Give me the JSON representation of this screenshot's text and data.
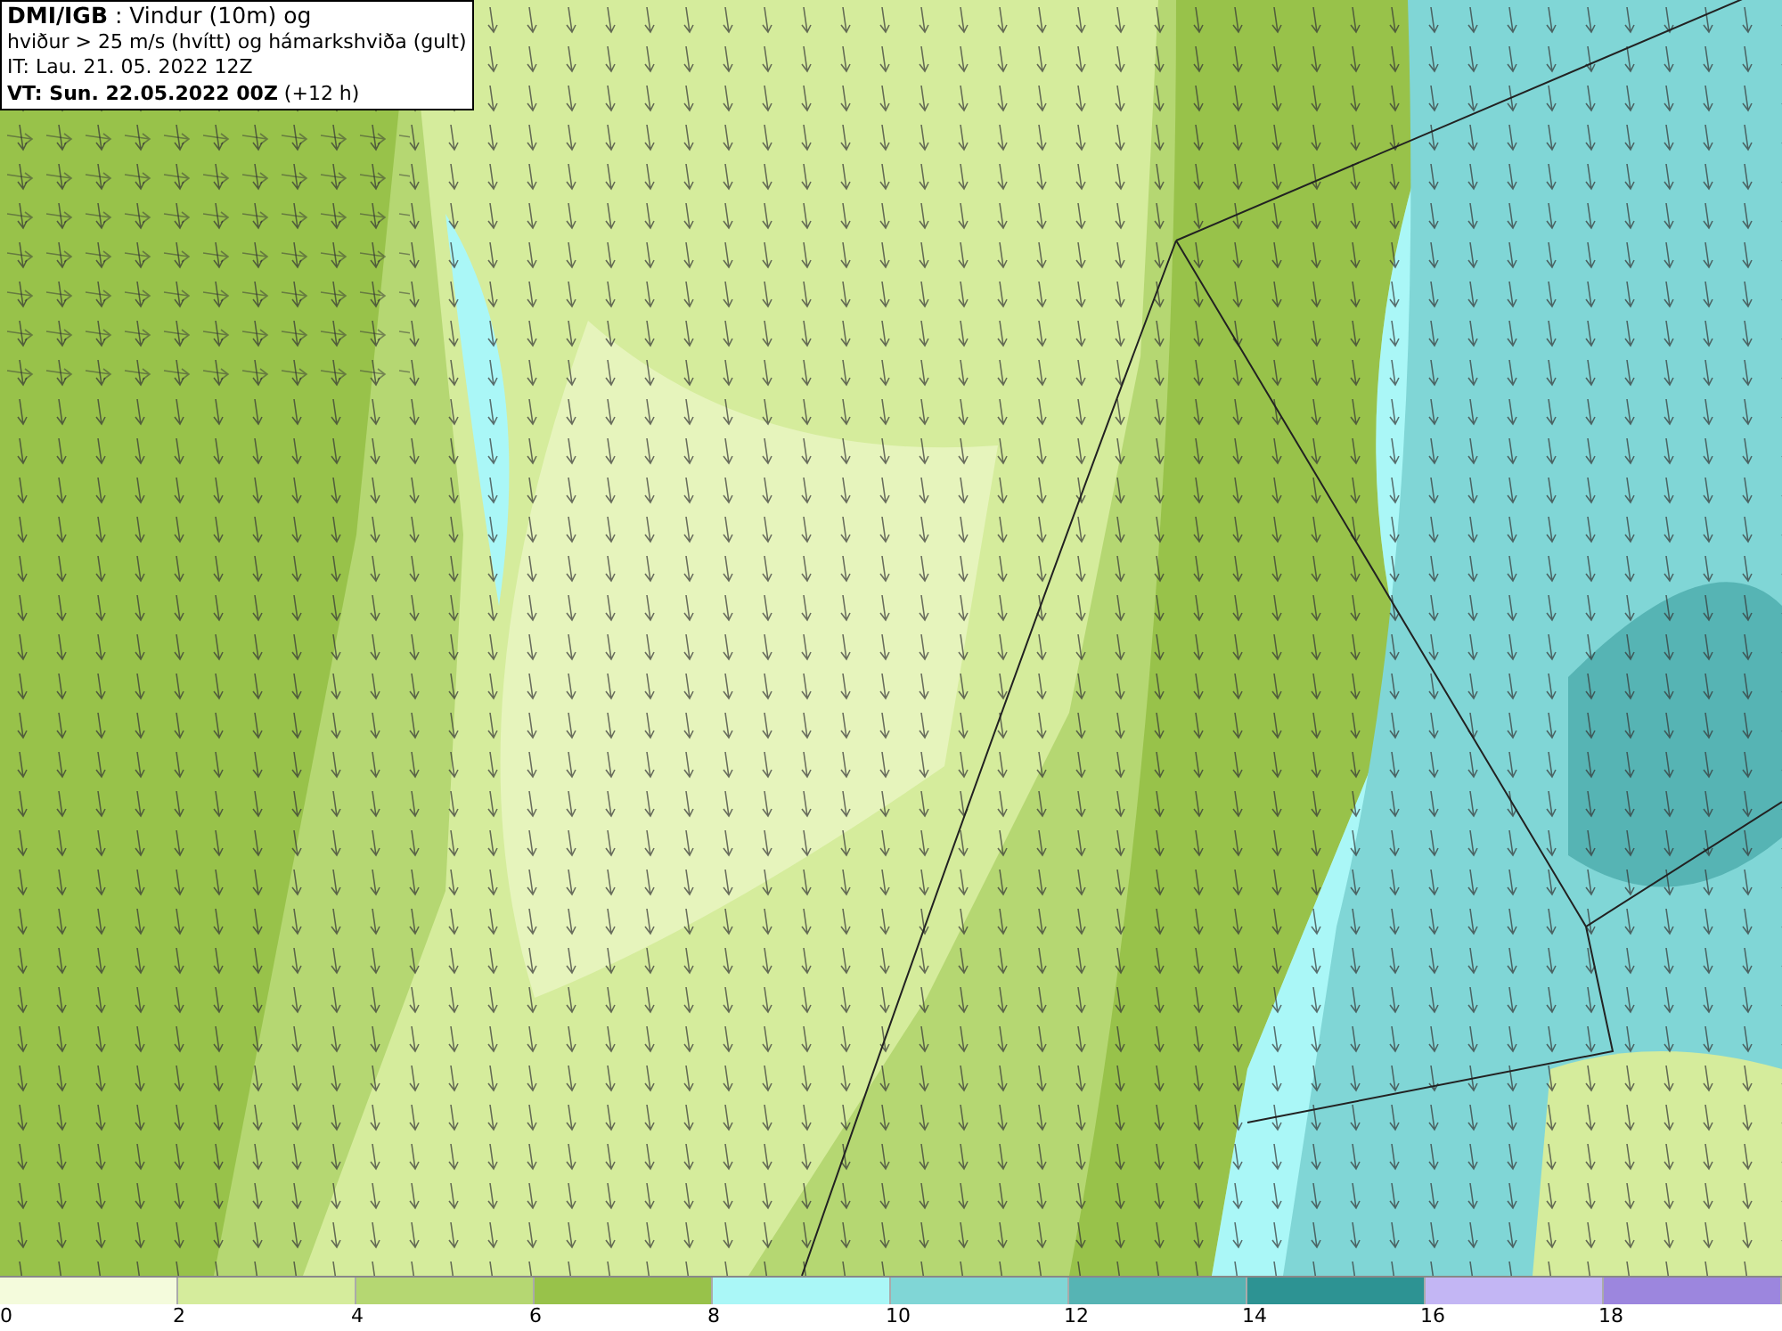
{
  "title_box": {
    "lines": [
      "**DMI/IGB** : Vindur (10m) og",
      "hviður > 25 m/s (hvítt) og hámarkshviða (gult)",
      "IT: Lau. 21. 05. 2022 12Z",
      "**VT: Sun. 22.05.2022 00Z** (+12 h)"
    ]
  },
  "legend": {
    "bins": [
      {
        "color": "#f4fbdc"
      },
      {
        "color": "#d5ec9c"
      },
      {
        "color": "#b5d772"
      },
      {
        "color": "#98c24a"
      },
      {
        "color": "#aaf7f7"
      },
      {
        "color": "#80d6d6"
      },
      {
        "color": "#56b4b4"
      },
      {
        "color": "#2d9393"
      },
      {
        "color": "#c3b6f4"
      },
      {
        "color": "#9c86de"
      }
    ],
    "ticks": [
      "0",
      "2",
      "4",
      "6",
      "8",
      "10",
      "12",
      "14",
      "16",
      "18"
    ]
  }
}
